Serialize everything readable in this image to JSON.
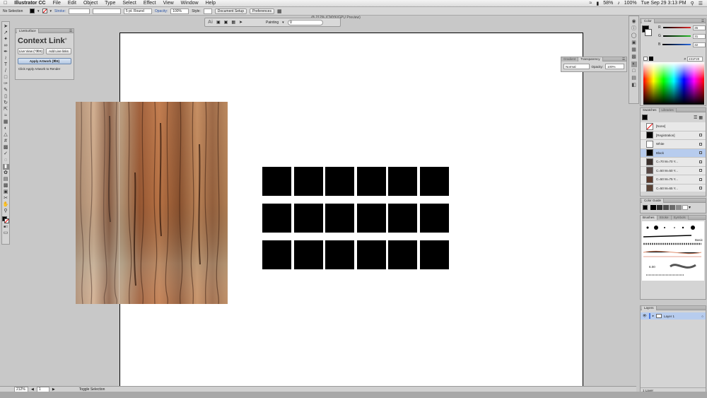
{
  "menubar": {
    "app_name": "Illustrator CC",
    "menus": [
      "File",
      "Edit",
      "Object",
      "Type",
      "Select",
      "Effect",
      "View",
      "Window",
      "Help"
    ],
    "battery": "58%",
    "zoom_status": "100%",
    "datetime": "Tue Sep 29  3:13 PM"
  },
  "control_bar": {
    "selection": "No Selection",
    "stroke_label": "Stroke:",
    "stroke_weight": "5 pt. Round",
    "opacity_label": "Opacity:",
    "opacity_value": "100%",
    "style_label": "Style:",
    "document_setup": "Document Setup",
    "preferences": "Preferences"
  },
  "document": {
    "title": "@ 212% (CMYK/GPU Preview)"
  },
  "app_toolbar": {
    "logo": "Ai",
    "workspace": "Painting"
  },
  "live_surface": {
    "tab": "LiveSurface",
    "title": "Context Link",
    "trademark": "®",
    "live_view_label": "Live View (^⌘R)",
    "add_live_links_label": "Add Live links",
    "apply_artwork_label": "Apply Artwork (⌘E)",
    "hint": "Click Apply Artwork to Render"
  },
  "gradient_panel": {
    "tabs": [
      "Gradient",
      "Transparency"
    ],
    "blend_mode": "Normal",
    "opacity_label": "Opacity:",
    "opacity_value": "100%"
  },
  "color_panel": {
    "tab": "Color",
    "channels": [
      {
        "label": "R",
        "value": "35",
        "color": "#e02828"
      },
      {
        "label": "G",
        "value": "31",
        "color": "#28c028"
      },
      {
        "label": "B",
        "value": "32",
        "color": "#2868e0"
      }
    ],
    "hex_label": "#",
    "hex": "231F20"
  },
  "swatches_panel": {
    "tabs": [
      "Swatches",
      "Libraries"
    ],
    "items": [
      {
        "name": "[None]",
        "color": "#ffffff"
      },
      {
        "name": "[Registration]",
        "color": "#000000"
      },
      {
        "name": "White",
        "color": "#ffffff"
      },
      {
        "name": "Black",
        "color": "#000000",
        "selected": true
      },
      {
        "name": "C=70 M=70 Y...",
        "color": "#3a302c"
      },
      {
        "name": "C=50 M=50 Y...",
        "color": "#574744"
      },
      {
        "name": "C=50 M=75 Y...",
        "color": "#5c3a2c"
      },
      {
        "name": "C=50 M=65 Y...",
        "color": "#5a4335"
      }
    ]
  },
  "color_guide_panel": {
    "tab": "Color Guide",
    "colors": [
      "#000000",
      "#2e2e2e",
      "#4a4a4a",
      "#6a6a6a",
      "#8c8c8c",
      "#ffffff"
    ]
  },
  "brushes_panel": {
    "tabs": [
      "Brushes",
      "Stroke",
      "Symbols"
    ],
    "basic_label": "Basic",
    "size_value": "6.00"
  },
  "layers_panel": {
    "tab": "Layers",
    "layer_name": "Layer 1",
    "layer_count": "1 Layer"
  },
  "status_bar": {
    "zoom": "212%",
    "artboard": "1",
    "tool": "Toggle Selection"
  },
  "artwork": {
    "grid_rows": 3,
    "grid_cols": 6,
    "cell_color": "#000000"
  }
}
